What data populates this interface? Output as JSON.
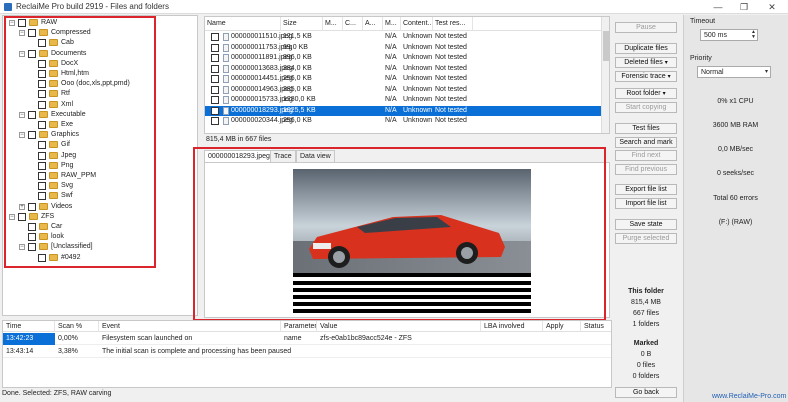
{
  "window": {
    "title": "ReclaiMe Pro build 2919 - Files and folders",
    "minimize": "—",
    "maximize": "❐",
    "close": "✕"
  },
  "tree": [
    {
      "label": "RAW",
      "depth": 0,
      "expander": "−",
      "folder": true
    },
    {
      "label": "Compressed",
      "depth": 1,
      "expander": "−",
      "folder": true
    },
    {
      "label": "Cab",
      "depth": 2,
      "expander": "",
      "folder": true
    },
    {
      "label": "Documents",
      "depth": 1,
      "expander": "−",
      "folder": true
    },
    {
      "label": "DocX",
      "depth": 2,
      "expander": "",
      "folder": true
    },
    {
      "label": "Html,htm",
      "depth": 2,
      "expander": "",
      "folder": true
    },
    {
      "label": "Ooo (doc,xls,ppt,pmd)",
      "depth": 2,
      "expander": "",
      "folder": true
    },
    {
      "label": "Rtf",
      "depth": 2,
      "expander": "",
      "folder": true
    },
    {
      "label": "Xml",
      "depth": 2,
      "expander": "",
      "folder": true
    },
    {
      "label": "Executable",
      "depth": 1,
      "expander": "−",
      "folder": true
    },
    {
      "label": "Exe",
      "depth": 2,
      "expander": "",
      "folder": true
    },
    {
      "label": "Graphics",
      "depth": 1,
      "expander": "−",
      "folder": true
    },
    {
      "label": "Gif",
      "depth": 2,
      "expander": "",
      "folder": true
    },
    {
      "label": "Jpeg",
      "depth": 2,
      "expander": "",
      "folder": true
    },
    {
      "label": "Png",
      "depth": 2,
      "expander": "",
      "folder": true
    },
    {
      "label": "RAW_PPM",
      "depth": 2,
      "expander": "",
      "folder": true
    },
    {
      "label": "Svg",
      "depth": 2,
      "expander": "",
      "folder": true
    },
    {
      "label": "Swf",
      "depth": 2,
      "expander": "",
      "folder": true
    },
    {
      "label": "Videos",
      "depth": 1,
      "expander": "+",
      "folder": true
    },
    {
      "label": "ZFS",
      "depth": 0,
      "expander": "−",
      "folder": true
    },
    {
      "label": "Car",
      "depth": 1,
      "expander": "",
      "folder": true
    },
    {
      "label": "look",
      "depth": 1,
      "expander": "",
      "folder": true
    },
    {
      "label": "[Unclassified]",
      "depth": 1,
      "expander": "−",
      "folder": true
    },
    {
      "label": "#0492",
      "depth": 2,
      "expander": "",
      "folder": true
    }
  ],
  "file_list": {
    "columns": [
      "Name",
      "Size",
      "M...",
      "C...",
      "A...",
      "M...",
      "Content...",
      "Test res..."
    ],
    "rows": [
      {
        "name": "000000011510.jpeg",
        "size": "121,5 KB",
        "m": "N/A",
        "content": "Unknown",
        "test": "Not tested",
        "selected": false
      },
      {
        "name": "000000011753.jpeg",
        "size": "69,0 KB",
        "m": "N/A",
        "content": "Unknown",
        "test": "Not tested",
        "selected": false
      },
      {
        "name": "000000011891.jpeg",
        "size": "896,0 KB",
        "m": "N/A",
        "content": "Unknown",
        "test": "Not tested",
        "selected": false
      },
      {
        "name": "000000013683.jpeg",
        "size": "384,0 KB",
        "m": "N/A",
        "content": "Unknown",
        "test": "Not tested",
        "selected": false
      },
      {
        "name": "000000014451.jpeg",
        "size": "256,0 KB",
        "m": "N/A",
        "content": "Unknown",
        "test": "Not tested",
        "selected": false
      },
      {
        "name": "000000014963.jpeg",
        "size": "385,0 KB",
        "m": "N/A",
        "content": "Unknown",
        "test": "Not tested",
        "selected": false
      },
      {
        "name": "000000015733.jpeg",
        "size": "1280,0 KB",
        "m": "N/A",
        "content": "Unknown",
        "test": "Not tested",
        "selected": false
      },
      {
        "name": "000000018293.jpeg",
        "size": "1025,5 KB",
        "m": "N/A",
        "content": "Unknown",
        "test": "Not tested",
        "selected": true
      },
      {
        "name": "000000020344.jpeg",
        "size": "256,0 KB",
        "m": "N/A",
        "content": "Unknown",
        "test": "Not tested",
        "selected": false
      }
    ],
    "summary": "815,4 MB in 667 files"
  },
  "preview": {
    "tabs": [
      "000000018293.jpeg",
      "Trace",
      "Data view"
    ],
    "active_tab": 0,
    "colors": {
      "car": "#d8311e",
      "road": "#8a8f96",
      "sky": "#c9d3da"
    }
  },
  "buttons": {
    "pause": "Pause",
    "duplicate_files": "Duplicate files",
    "deleted_files": "Deleted files",
    "forensic_trace": "Forensic trace",
    "root_folder": "Root folder",
    "start_copying": "Start copying",
    "test_files": "Test files",
    "search_and_mark": "Search and mark",
    "find_next": "Find next",
    "find_previous": "Find previous",
    "export_file_list": "Export file list",
    "import_file_list": "Import file list",
    "save_state": "Save state",
    "purge_selected": "Purge selected",
    "go_back": "Go back",
    "dropdown_arrow": "▾"
  },
  "this_folder": {
    "title": "This folder",
    "size": "815,4 MB",
    "files": "667 files",
    "folders": "1 folders"
  },
  "marked": {
    "title": "Marked",
    "size": "0 B",
    "files": "0 files",
    "folders": "0 folders"
  },
  "side_panel": {
    "timeout_label": "Timeout",
    "timeout_value": "500 ms",
    "priority_label": "Priority",
    "priority_value": "Normal",
    "cpu": "0% x1 CPU",
    "ram": "3600 MB RAM",
    "mb_sec": "0,0 MB/sec",
    "seeks_sec": "0 seeks/sec",
    "errors": "Total 60 errors",
    "drive": "(F:) (RAW)"
  },
  "log": {
    "columns": [
      "Time",
      "Scan %",
      "Event",
      "Parameter",
      "Value",
      "LBA involved",
      "Apply",
      "Status"
    ],
    "rows": [
      {
        "time": "13:42:23",
        "scan": "0,00%",
        "event": "Filesystem scan launched on",
        "parameter": "name",
        "value": "zfs-e0ab1bc89acc524e - ZFS",
        "selected": true
      },
      {
        "time": "13:43:14",
        "scan": "3,38%",
        "event": "The initial scan is complete and processing has been paused",
        "parameter": "",
        "value": "",
        "selected": false
      }
    ]
  },
  "status_bar": "Done.  Selected: ZFS, RAW carving",
  "footer_link": "www.ReclaiMe-Pro.com"
}
